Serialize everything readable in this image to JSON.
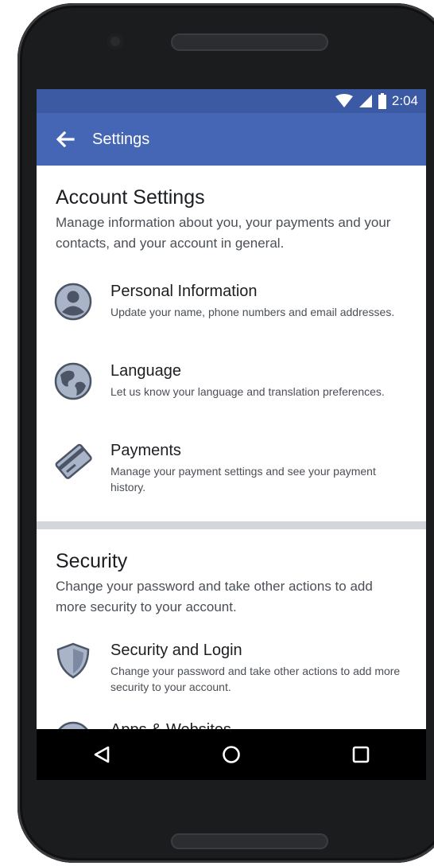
{
  "status_bar": {
    "time": "2:04"
  },
  "app_bar": {
    "title": "Settings"
  },
  "account_section": {
    "title": "Account Settings",
    "description": "Manage information about you, your payments and your contacts, and your account in general.",
    "items": [
      {
        "title": "Personal Information",
        "description": "Update your name, phone numbers and email addresses.",
        "icon": "person-icon"
      },
      {
        "title": "Language",
        "description": "Let us know your language and translation preferences.",
        "icon": "globe-icon"
      },
      {
        "title": "Payments",
        "description": "Manage your payment settings and see your payment history.",
        "icon": "credit-card-icon"
      }
    ]
  },
  "security_section": {
    "title": "Security",
    "description": "Change your password and take other actions to add more security to your account.",
    "items": [
      {
        "title": "Security and Login",
        "description": "Change your password and take other actions to add more security to your account.",
        "icon": "shield-icon"
      },
      {
        "title": "Apps & Websites",
        "description": "",
        "icon": "arrow-right-circle-icon"
      }
    ]
  },
  "colors": {
    "status_bar": "#3b5aa3",
    "app_bar": "#4566b4",
    "icon_fill": "#a9b4c8",
    "icon_stroke": "#4b5566",
    "divider": "#d3d6db"
  }
}
